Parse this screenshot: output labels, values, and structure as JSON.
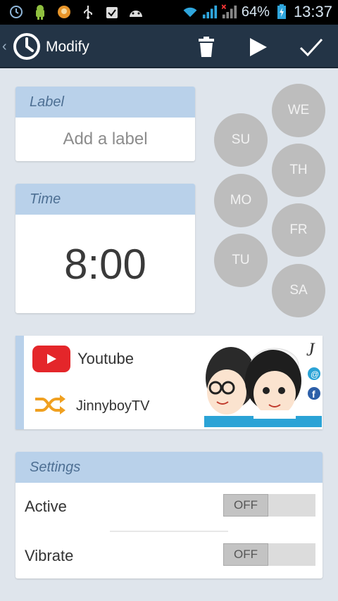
{
  "status_bar": {
    "battery_percent": "64%",
    "time": "13:37",
    "icons": [
      "alarm-clock-icon",
      "android-icon",
      "avatar-icon",
      "usb-icon",
      "clipboard-check-icon",
      "android-head-icon",
      "wifi-icon",
      "signal-icon",
      "signal-no-sim-icon",
      "battery-charging-icon"
    ]
  },
  "action_bar": {
    "title": "Modify",
    "icons": [
      "back-chevron-icon",
      "clock-icon",
      "trash-icon",
      "play-icon",
      "check-icon"
    ]
  },
  "label_card": {
    "header": "Label",
    "placeholder": "Add a label"
  },
  "time_card": {
    "header": "Time",
    "value": "8:00"
  },
  "days": {
    "su": "SU",
    "mo": "MO",
    "tu": "TU",
    "we": "WE",
    "th": "TH",
    "fr": "FR",
    "sa": "SA"
  },
  "media": {
    "source": "Youtube",
    "channel": "JinnyboyTV",
    "icons": [
      "youtube-logo-icon",
      "shuffle-icon"
    ]
  },
  "settings": {
    "header": "Settings",
    "active_label": "Active",
    "active_state": "OFF",
    "vibrate_label": "Vibrate",
    "vibrate_state": "OFF"
  },
  "colors": {
    "action_bar": "#233446",
    "card_header": "#b9d1ea",
    "background": "#dfe5ec",
    "day_circle": "#bdbdbd",
    "youtube_red": "#e4262a",
    "shuffle_orange": "#f0a020"
  }
}
